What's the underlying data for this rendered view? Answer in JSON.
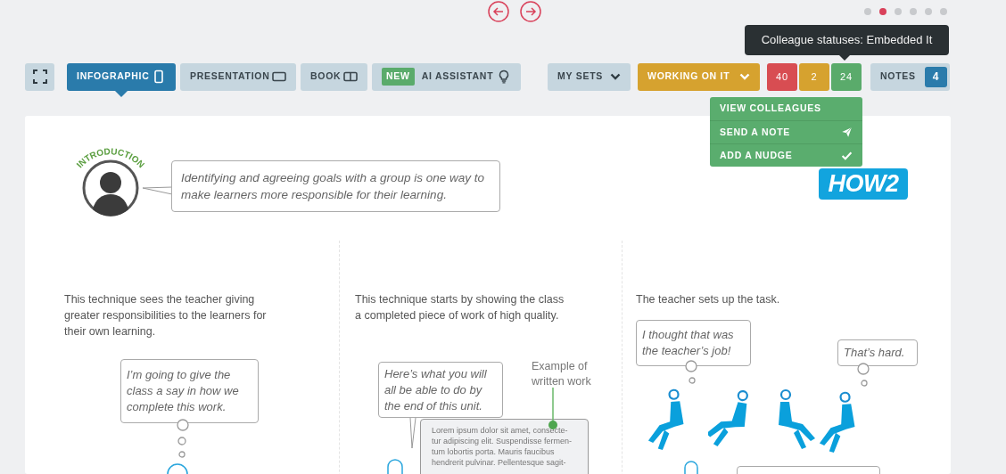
{
  "pager": {
    "dots": [
      {
        "selected": false
      },
      {
        "selected": true
      },
      {
        "selected": false
      },
      {
        "selected": false
      },
      {
        "selected": false
      },
      {
        "selected": false
      }
    ]
  },
  "toolbar": {
    "view_modes": [
      {
        "label": "INFOGRAPHIC",
        "selected": true,
        "kind": "portrait"
      },
      {
        "label": "PRESENTATION",
        "selected": false,
        "kind": "landscape"
      },
      {
        "label": "BOOK",
        "selected": false,
        "kind": "book"
      },
      {
        "label": "AI ASSISTANT",
        "selected": false,
        "kind": "bulb",
        "badge": "NEW"
      }
    ],
    "my_sets": "MY SETS",
    "status": "WORKING ON IT",
    "counts": [
      {
        "value": "40",
        "color": "#d84d52"
      },
      {
        "value": "2",
        "color": "#d6a22f"
      },
      {
        "value": "24",
        "color": "#5aab6b"
      }
    ],
    "notes": {
      "label": "NOTES",
      "count": "4"
    }
  },
  "tooltip": "Colleague statuses: Embedded It",
  "menu": [
    {
      "label": "VIEW COLLEAGUES",
      "kind": "plain"
    },
    {
      "label": "SEND A NOTE",
      "kind": "send"
    },
    {
      "label": "ADD A NUDGE",
      "kind": "check"
    }
  ],
  "infographic": {
    "intro_label": "INTRODUCTION",
    "intro_text": "Identifying and agreeing goals with a group is one way to make learners more responsible for their learning.",
    "logo": "HOW2",
    "columns": [
      {
        "text": "This technique sees the teacher giving greater responsibilities to the learners for their own learning.",
        "bubbles": [
          "I’m going to give the class a say in how we complete this work."
        ]
      },
      {
        "text": "This technique starts by showing the class a completed piece of work of high quality.",
        "bubbles": [
          "Here’s what you will all be able to do by the end of this unit."
        ],
        "example_label": "Example of written work",
        "example_lines": [
          "Lorem ipsum dolor sit amet, consecte-",
          "tur adipiscing elit. Suspendisse fermen-",
          "tum lobortis porta. Mauris faucibus",
          "hendrerit pulvinar. Pellentesque sagit-"
        ]
      },
      {
        "text": "The teacher sets up the task.",
        "bubbles": [
          "I thought that was the teacher’s job!",
          "That’s hard."
        ]
      }
    ]
  }
}
